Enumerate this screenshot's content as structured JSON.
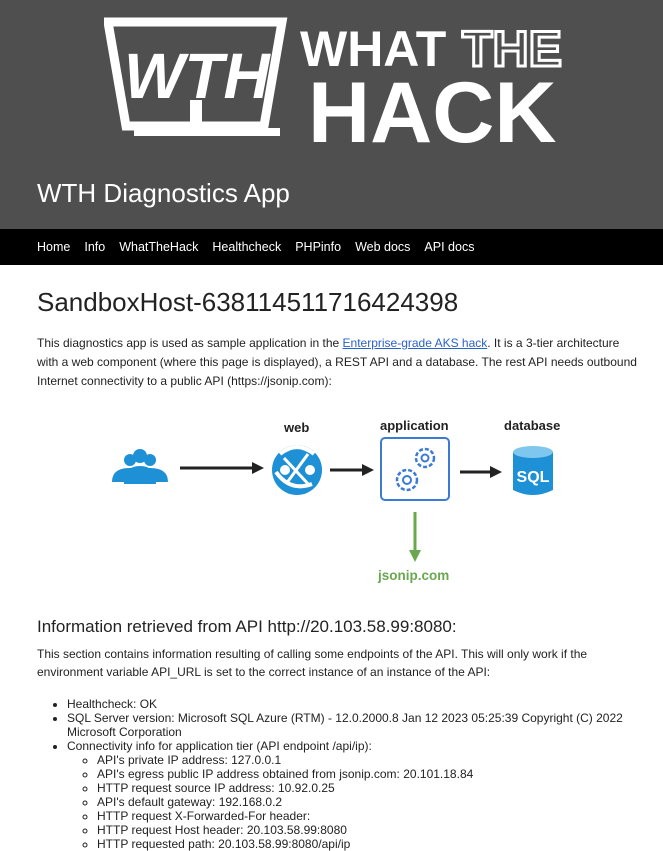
{
  "logo": {
    "text_wth": "WTH",
    "text_what": "WHAT",
    "text_the": "THE",
    "text_hack": "HACK"
  },
  "app_title": "WTH Diagnostics App",
  "nav": [
    "Home",
    "Info",
    "WhatTheHack",
    "Healthcheck",
    "PHPinfo",
    "Web docs",
    "API docs"
  ],
  "host": "SandboxHost-638114511716424398",
  "intro": {
    "before": "This diagnostics app is used as sample application in the ",
    "link": "Enterprise-grade AKS hack",
    "after": ". It is a 3-tier architecture with a web component (where this page is displayed), a REST API and a database. The rest API needs outbound Internet connectivity to a public API (https://jsonip.com):"
  },
  "diagram": {
    "web": "web",
    "application": "application",
    "database": "database",
    "sql": "SQL",
    "jsonip": "jsonip.com",
    "colors": {
      "blue": "#1e90d6",
      "green": "#6aa84f",
      "dark": "#222222"
    }
  },
  "api": {
    "heading": "Information retrieved from API http://20.103.58.99:8080:",
    "desc": "This section contains information resulting of calling some endpoints of the API. This will only work if the environment variable API_URL is set to the correct instance of an instance of the API:"
  },
  "info": {
    "healthcheck": "Healthcheck: OK",
    "sql_version": "SQL Server version: Microsoft SQL Azure (RTM) - 12.0.2000.8 Jan 12 2023 05:25:39 Copyright (C) 2022 Microsoft Corporation",
    "connectivity": "Connectivity info for application tier (API endpoint /api/ip):",
    "sub": [
      "API's private IP address: 127.0.0.1",
      "API's egress public IP address obtained from jsonip.com: 20.101.18.84",
      "HTTP request source IP address: 10.92.0.25",
      "API's default gateway: 192.168.0.2",
      "HTTP request X-Forwarded-For header:",
      "HTTP request Host header: 20.103.58.99:8080",
      "HTTP requested path: 20.103.58.99:8080/api/ip"
    ]
  }
}
